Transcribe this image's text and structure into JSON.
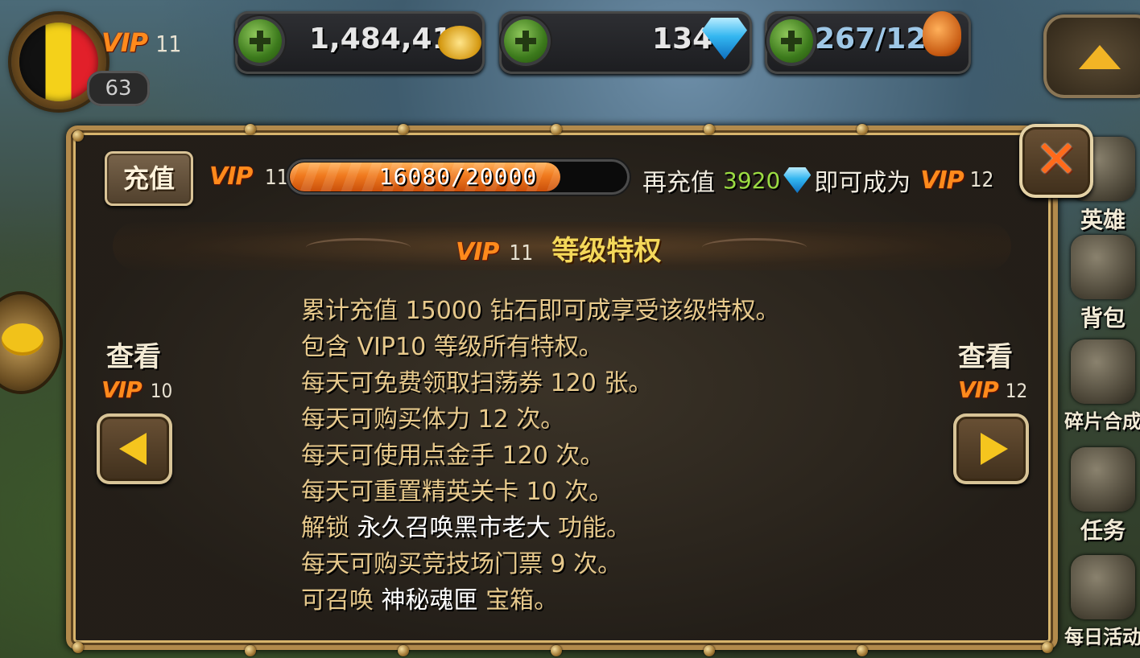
{
  "hud": {
    "vip_label": "VIP",
    "vip_level": "11",
    "player_level": "63",
    "gold": "1,484,414",
    "diamonds": "134",
    "stamina": "267/123"
  },
  "side_menu": [
    {
      "label": "英雄"
    },
    {
      "label": "背包"
    },
    {
      "label": "碎片合成"
    },
    {
      "label": "任务"
    },
    {
      "label": "每日活动"
    }
  ],
  "dialog": {
    "recharge_button": "充值",
    "current_vip_label": "VIP",
    "current_vip_level": "11",
    "progress_text": "16080/20000",
    "progress_ratio": 0.804,
    "recharge_prefix": "再充值",
    "recharge_amount": "3920",
    "recharge_suffix": "即可成为",
    "next_vip_label": "VIP",
    "next_vip_level": "12",
    "banner_vip_label": "VIP",
    "banner_vip_level": "11",
    "banner_title": "等级特权",
    "perks": [
      {
        "prefix": "累计充值 15000 钻石即可成享受该级特权。"
      },
      {
        "prefix": "包含 VIP10 等级所有特权。"
      },
      {
        "prefix": "每天可免费领取扫荡券 120 张。"
      },
      {
        "prefix": "每天可购买体力 12 次。"
      },
      {
        "prefix": "每天可使用点金手 120 次。"
      },
      {
        "prefix": "每天可重置精英关卡 10 次。"
      },
      {
        "prefix": "解锁 ",
        "highlight": "永久召唤黑市老大",
        "suffix": " 功能。"
      },
      {
        "prefix": "每天可购买竞技场门票 9 次。"
      },
      {
        "prefix": "可召唤 ",
        "highlight": "神秘魂匣",
        "suffix": " 宝箱。"
      }
    ],
    "prev_view_label": "查看",
    "prev_vip_label": "VIP",
    "prev_vip_level": "10",
    "next_view_label": "查看",
    "next_nav_vip_label": "VIP",
    "next_nav_vip_level": "12",
    "close_glyph": "✕"
  },
  "colors": {
    "accent_orange": "#f07a1e",
    "gold_text": "#e7c98c",
    "green_amount": "#9bdc42",
    "banner_yellow": "#f4d85a"
  }
}
